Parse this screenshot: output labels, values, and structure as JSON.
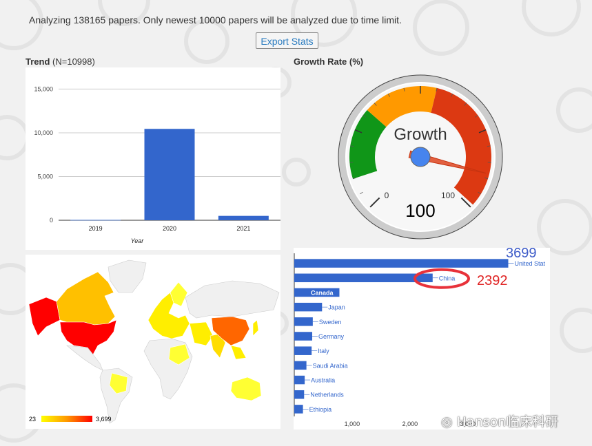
{
  "status_message": "Analyzing 138165 papers. Only newest 10000 papers will be analyzed due to time limit.",
  "export_button_label": "Export Stats",
  "trend": {
    "title": "Trend",
    "count_label": "(N=10998)",
    "chart_data": {
      "type": "bar",
      "categories": [
        "2019",
        "2020",
        "2021"
      ],
      "values": [
        40,
        10450,
        500
      ],
      "xlabel": "Year",
      "ylabel": "",
      "yticks": [
        "0",
        "5,000",
        "10,000",
        "15,000"
      ],
      "ylim": [
        0,
        15900
      ],
      "color": "#3366cc",
      "grid": true
    }
  },
  "growth": {
    "title": "Growth Rate (%)",
    "gauge_label": "Growth",
    "value_label": "100",
    "min_label": "0",
    "max_label": "100",
    "value": 100,
    "colors": {
      "green": "#109618",
      "orange": "#ff9900",
      "red": "#dc3912",
      "needle": "#dc3912",
      "hub": "#4684ee"
    }
  },
  "map": {
    "legend_min": "23",
    "legend_max": "3,699",
    "colors": {
      "low": "#ffff00",
      "high": "#ff0000",
      "none": "#f0f0f0"
    }
  },
  "countries": {
    "chart_data": {
      "type": "bar",
      "orientation": "horizontal",
      "categories": [
        "United States",
        "China",
        "Canada",
        "Japan",
        "Sweden",
        "Germany",
        "Italy",
        "Saudi Arabia",
        "Australia",
        "Netherlands",
        "Ethiopia"
      ],
      "values": [
        3699,
        2392,
        780,
        480,
        320,
        310,
        300,
        210,
        180,
        170,
        150
      ],
      "xticks": [
        "1,000",
        "2,000",
        "3,000"
      ],
      "xlim": [
        0,
        4420
      ],
      "color": "#3366cc"
    },
    "truncated_top_label": "United Stat",
    "annotations": {
      "us_value": "3699",
      "china_value": "2392"
    }
  },
  "watermark": "Hanson临床科研"
}
